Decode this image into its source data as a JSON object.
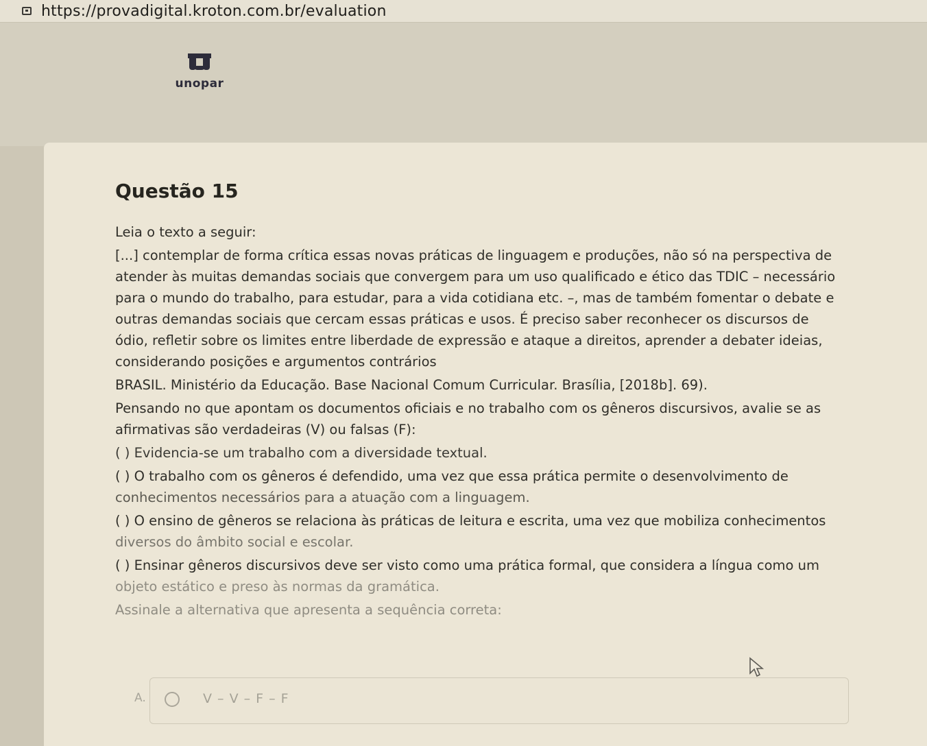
{
  "browser": {
    "url": "https://provadigital.kroton.com.br/evaluation"
  },
  "logo": {
    "text": "unopar"
  },
  "question": {
    "title": "Questão 15",
    "intro": "Leia o texto a seguir:",
    "quote": [
      "[...] contemplar de forma crítica essas novas práticas de linguagem e produções, não só na perspectiva de",
      "atender às muitas demandas sociais que convergem para um uso qualificado e ético das TDIC – necessário",
      "para o mundo do trabalho, para estudar, para a vida cotidiana etc. –, mas de também fomentar o debate e",
      "outras demandas sociais que cercam essas práticas e usos. É preciso saber reconhecer os discursos de",
      "ódio, refletir sobre os limites entre liberdade de expressão e ataque a direitos, aprender a debater ideias,",
      "considerando posições e argumentos contrários"
    ],
    "source": "BRASIL. Ministério da Educação. Base Nacional Comum Curricular. Brasília, [2018b]. 69).",
    "prompt": [
      "Pensando no que apontam os documentos oficiais e no trabalho com os gêneros discursivos, avalie se as",
      "afirmativas são verdadeiras (V) ou falsas (F):"
    ],
    "statements": [
      [
        "(   ) Evidencia-se um trabalho com a diversidade textual."
      ],
      [
        "(   ) O trabalho com os gêneros é defendido, uma vez que essa prática permite o desenvolvimento de",
        "conhecimentos necessários para a atuação com a linguagem."
      ],
      [
        "(   ) O ensino de gêneros se relaciona às práticas de leitura e escrita, uma vez que mobiliza conhecimentos",
        "diversos do âmbito social e escolar."
      ],
      [
        "(   ) Ensinar gêneros discursivos deve ser visto como uma prática formal, que considera a língua como um",
        "objeto estático e preso às normas da gramática."
      ]
    ],
    "instruction": "Assinale a alternativa que apresenta a sequência correta:"
  },
  "options": [
    {
      "letter": "A.",
      "text": "V – V – F – F"
    }
  ]
}
